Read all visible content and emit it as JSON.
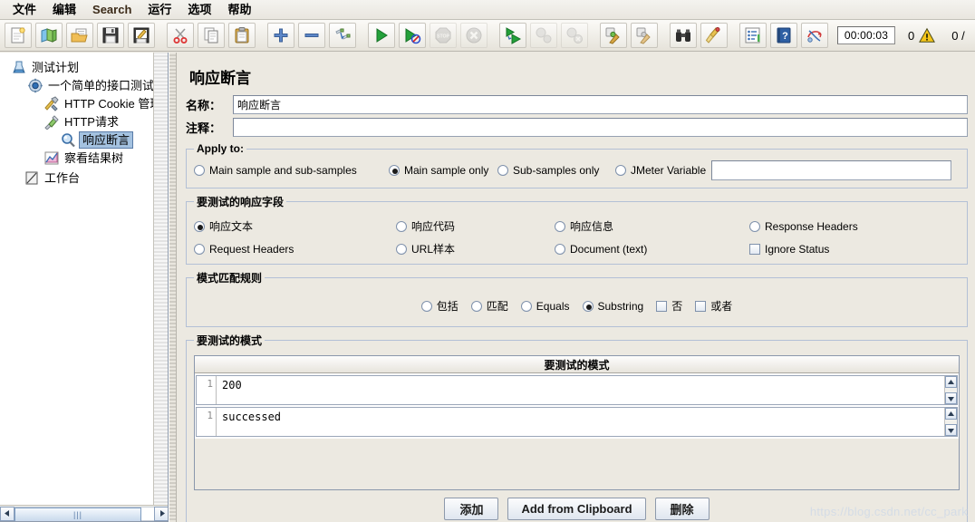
{
  "window": {
    "menu": [
      {
        "label": "文件",
        "name": "menu-file"
      },
      {
        "label": "编辑",
        "name": "menu-edit"
      },
      {
        "label": "Search",
        "name": "menu-search"
      },
      {
        "label": "运行",
        "name": "menu-run"
      },
      {
        "label": "选项",
        "name": "menu-options"
      },
      {
        "label": "帮助",
        "name": "menu-help"
      }
    ]
  },
  "toolbar": {
    "buttons": [
      {
        "icon": "new-file-icon",
        "name": "new-button"
      },
      {
        "icon": "templates-icon",
        "name": "templates-button"
      },
      {
        "icon": "open-folder-icon",
        "name": "open-button"
      },
      {
        "icon": "save-disk-icon",
        "name": "save-button"
      },
      {
        "icon": "save-as-icon",
        "name": "save-as-button"
      },
      {
        "icon": "scissors-icon",
        "name": "cut-button"
      },
      {
        "icon": "copy-icon",
        "name": "copy-button"
      },
      {
        "icon": "paste-clipboard-icon",
        "name": "paste-button"
      },
      {
        "icon": "plus-icon",
        "name": "expand-button"
      },
      {
        "icon": "minus-icon",
        "name": "collapse-button"
      },
      {
        "icon": "toggle-icon",
        "name": "toggle-button"
      },
      {
        "icon": "play-icon",
        "name": "start-button"
      },
      {
        "icon": "play-no-timers-icon",
        "name": "start-no-pauses-button"
      },
      {
        "icon": "stop-icon",
        "name": "stop-button"
      },
      {
        "icon": "shutdown-icon",
        "name": "shutdown-button"
      },
      {
        "icon": "play-remote-icon",
        "name": "remote-start-all-button"
      },
      {
        "icon": "stop-remote-icon",
        "name": "remote-stop-all-button"
      },
      {
        "icon": "shutdown-remote-icon",
        "name": "remote-shutdown-all-button"
      },
      {
        "icon": "clear-icon",
        "name": "clear-button"
      },
      {
        "icon": "clear-all-icon",
        "name": "clear-all-button"
      },
      {
        "icon": "binoculars-icon",
        "name": "search-button"
      },
      {
        "icon": "broom-icon",
        "name": "search-reset-button"
      },
      {
        "icon": "function-helper-icon",
        "name": "function-helper-button"
      },
      {
        "icon": "help-book-icon",
        "name": "help-button"
      },
      {
        "icon": "undo-redo-icon",
        "name": "toolbar-extra-button"
      }
    ],
    "timer": "00:00:03",
    "error_count": "0",
    "thread_count": "0 /"
  },
  "tree": {
    "nodes": [
      {
        "label": "测试计划",
        "icon": "test-plan-icon",
        "depth": 0,
        "selected": false,
        "name": "tree-node-test-plan"
      },
      {
        "label": "一个简单的接口测试",
        "icon": "thread-group-icon",
        "depth": 1,
        "selected": false,
        "name": "tree-node-thread-group"
      },
      {
        "label": "HTTP Cookie 管理",
        "icon": "cookie-manager-icon",
        "depth": 2,
        "selected": false,
        "name": "tree-node-cookie-manager"
      },
      {
        "label": "HTTP请求",
        "icon": "http-request-icon",
        "depth": 2,
        "selected": false,
        "name": "tree-node-http-request"
      },
      {
        "label": "响应断言",
        "icon": "assertion-icon",
        "depth": 3,
        "selected": true,
        "name": "tree-node-response-assertion"
      },
      {
        "label": "察看结果树",
        "icon": "view-results-tree-icon",
        "depth": 2,
        "selected": false,
        "name": "tree-node-view-results-tree"
      },
      {
        "label": "工作台",
        "icon": "workbench-icon",
        "depth": 0,
        "selected": false,
        "name": "tree-node-workbench"
      }
    ]
  },
  "panel": {
    "title": "响应断言",
    "name_label": "名称：",
    "name_value": "响应断言",
    "comment_label": "注释：",
    "comment_value": "",
    "apply_to": {
      "legend": "Apply to:",
      "options": [
        {
          "label": "Main sample and sub-samples",
          "selected": false,
          "name": "radio-main-and-sub"
        },
        {
          "label": "Main sample only",
          "selected": true,
          "name": "radio-main-only"
        },
        {
          "label": "Sub-samples only",
          "selected": false,
          "name": "radio-sub-only"
        },
        {
          "label": "JMeter Variable",
          "selected": false,
          "name": "radio-jmeter-variable"
        }
      ],
      "variable_value": ""
    },
    "response_field": {
      "legend": "要测试的响应字段",
      "row1": [
        {
          "label": "响应文本",
          "type": "radio",
          "selected": true,
          "name": "radio-response-text"
        },
        {
          "label": "响应代码",
          "type": "radio",
          "selected": false,
          "name": "radio-response-code"
        },
        {
          "label": "响应信息",
          "type": "radio",
          "selected": false,
          "name": "radio-response-message"
        },
        {
          "label": "Response Headers",
          "type": "radio",
          "selected": false,
          "name": "radio-response-headers"
        }
      ],
      "row2": [
        {
          "label": "Request Headers",
          "type": "radio",
          "selected": false,
          "name": "radio-request-headers"
        },
        {
          "label": "URL样本",
          "type": "radio",
          "selected": false,
          "name": "radio-url-sample"
        },
        {
          "label": "Document (text)",
          "type": "radio",
          "selected": false,
          "name": "radio-document-text"
        },
        {
          "label": "Ignore Status",
          "type": "checkbox",
          "selected": false,
          "name": "checkbox-ignore-status"
        }
      ]
    },
    "pattern_rules": {
      "legend": "模式匹配规则",
      "options": [
        {
          "label": "包括",
          "type": "radio",
          "selected": false,
          "name": "radio-contains"
        },
        {
          "label": "匹配",
          "type": "radio",
          "selected": false,
          "name": "radio-matches"
        },
        {
          "label": "Equals",
          "type": "radio",
          "selected": false,
          "name": "radio-equals"
        },
        {
          "label": "Substring",
          "type": "radio",
          "selected": true,
          "name": "radio-substring"
        },
        {
          "label": "否",
          "type": "checkbox",
          "selected": false,
          "name": "checkbox-not"
        },
        {
          "label": "或者",
          "type": "checkbox",
          "selected": false,
          "name": "checkbox-or"
        }
      ]
    },
    "patterns": {
      "legend": "要测试的模式",
      "column_header": "要测试的模式",
      "rows": [
        {
          "line_no": "1",
          "value": "200",
          "name": "pattern-row-1"
        },
        {
          "line_no": "1",
          "value": "successed",
          "name": "pattern-row-2"
        }
      ]
    },
    "buttons": [
      {
        "label": "添加",
        "name": "add-button"
      },
      {
        "label": "Add from Clipboard",
        "name": "add-from-clipboard-button"
      },
      {
        "label": "删除",
        "name": "delete-button"
      }
    ]
  },
  "watermark": "https://blog.csdn.net/cc_park"
}
